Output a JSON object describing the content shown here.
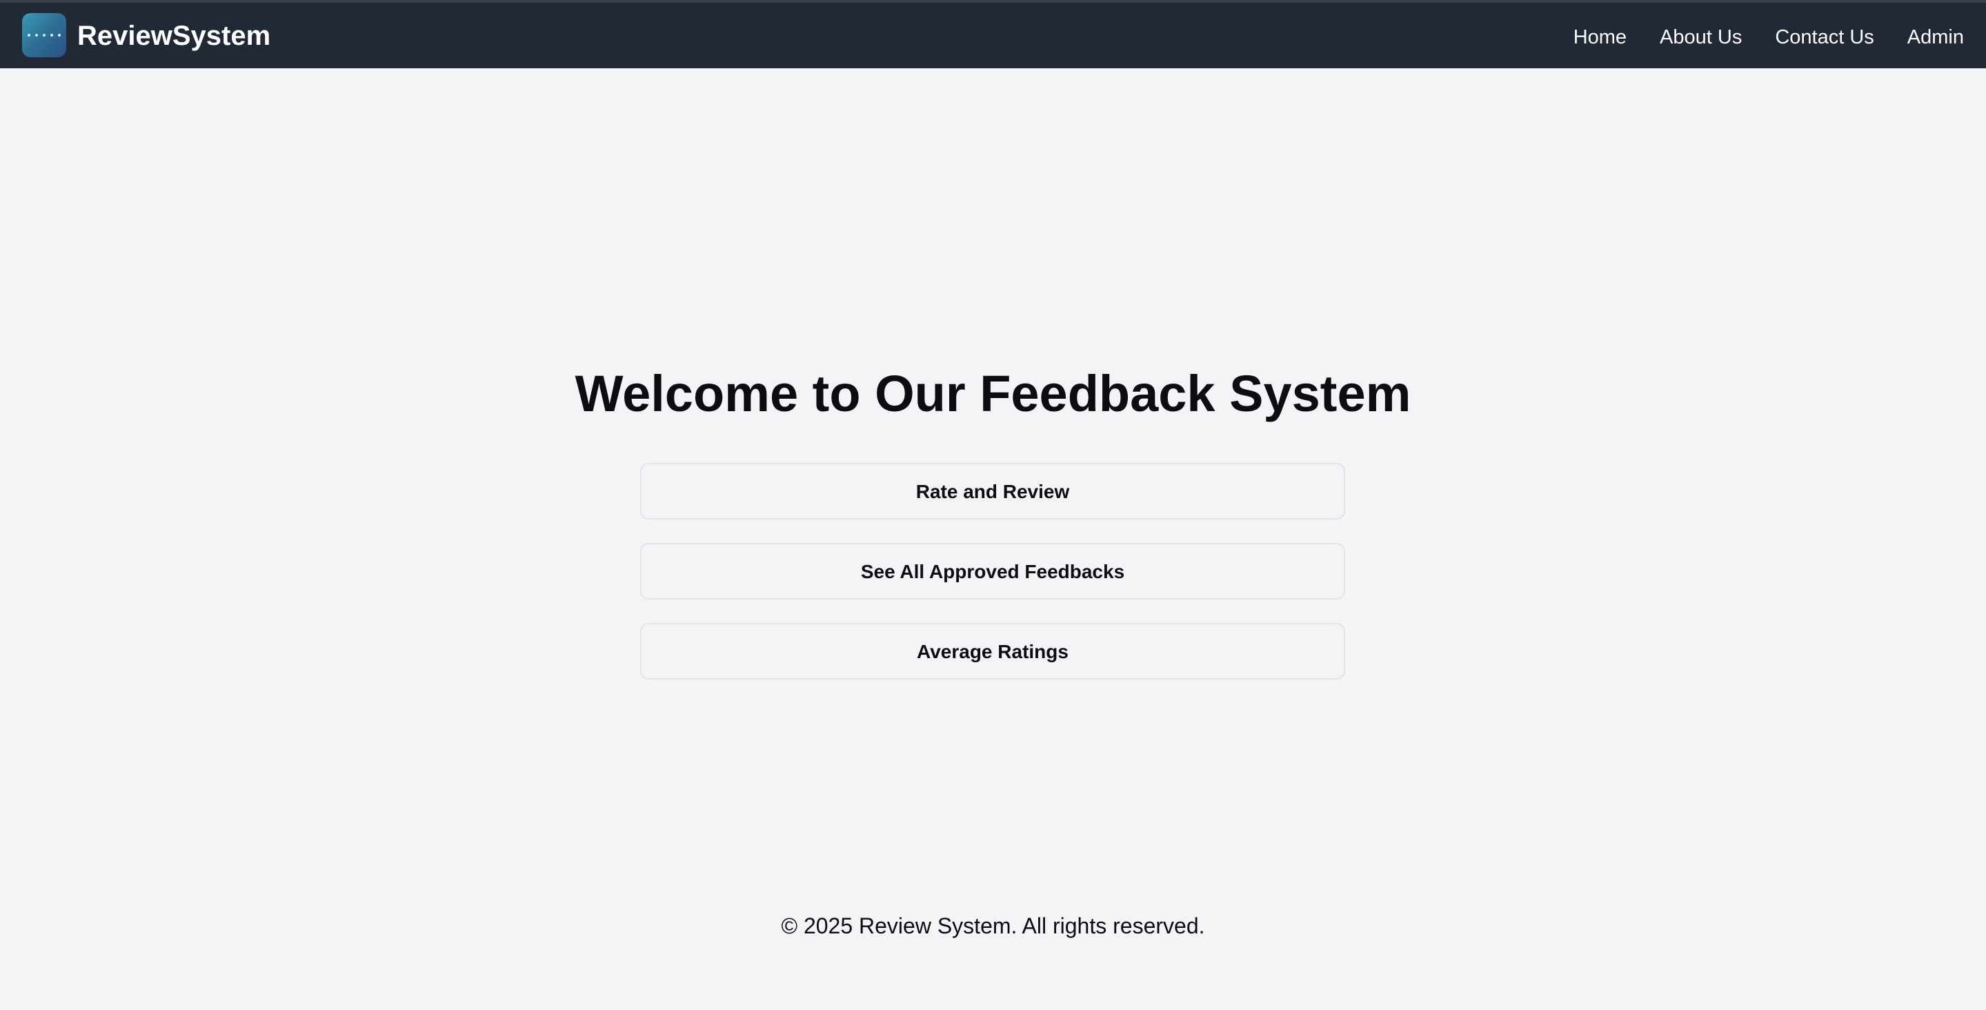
{
  "header": {
    "brand": "ReviewSystem",
    "logo_icon": "app-logo-icon",
    "nav": [
      "Home",
      "About Us",
      "Contact Us",
      "Admin"
    ]
  },
  "main": {
    "title": "Welcome to Our Feedback System",
    "buttons": [
      "Rate and Review",
      "See All Approved Feedbacks",
      "Average Ratings"
    ]
  },
  "footer": {
    "text": "© 2025 Review System. All rights reserved."
  },
  "colors": {
    "header_bg": "#212836",
    "page_bg": "#f3f4f6",
    "text": "#0b0d12"
  }
}
